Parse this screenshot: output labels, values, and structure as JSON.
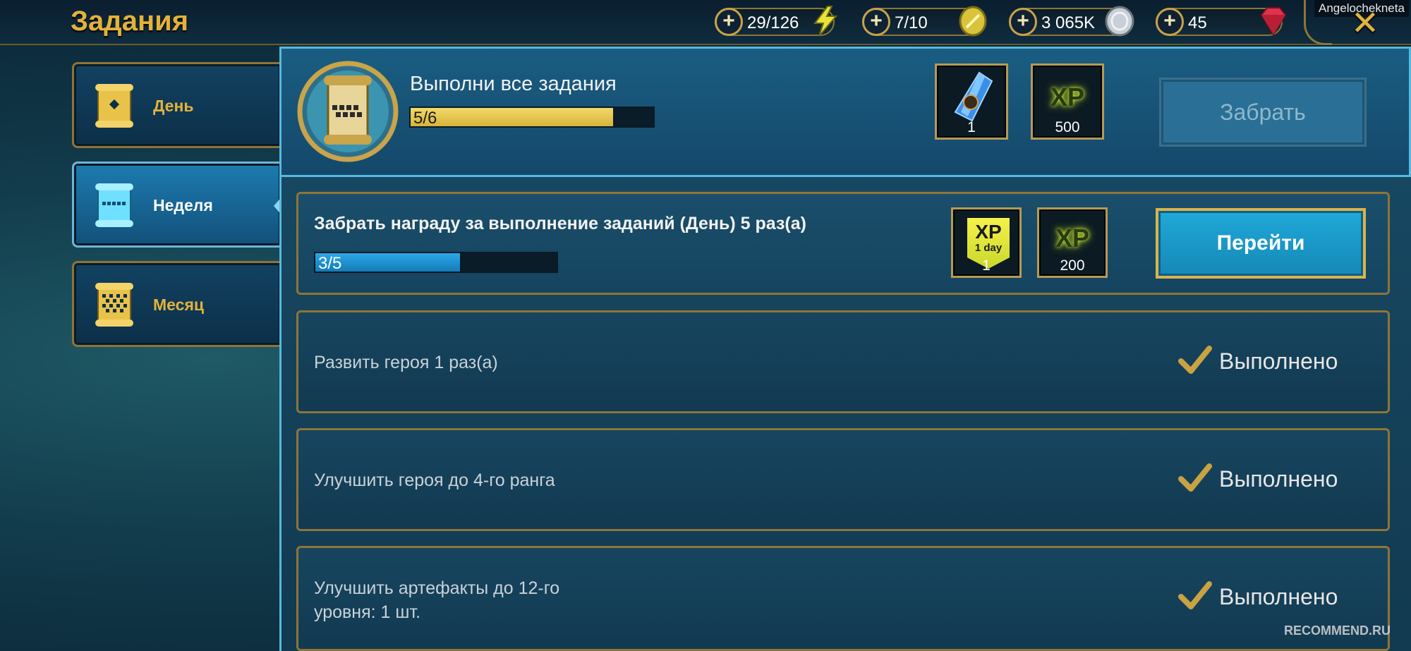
{
  "header": {
    "title": "Задания",
    "username": "Angelochekneta",
    "close_label": "✕"
  },
  "resources": [
    {
      "name": "energy",
      "value": "29/126",
      "icon": "lightning-icon",
      "color": "#e8e23a"
    },
    {
      "name": "arena-tokens",
      "value": "7/10",
      "icon": "gold-token-icon",
      "color": "#d8c33a"
    },
    {
      "name": "silver",
      "value": "3 065K",
      "icon": "silver-coin-icon",
      "color": "#c9cfd6"
    },
    {
      "name": "gems",
      "value": "45",
      "icon": "ruby-gem-icon",
      "color": "#e0324a"
    }
  ],
  "sidebar": {
    "tabs": [
      {
        "label": "День",
        "active": false,
        "icon": "scroll-icon"
      },
      {
        "label": "Неделя",
        "active": true,
        "icon": "scroll-icon"
      },
      {
        "label": "Месяц",
        "active": false,
        "icon": "scroll-icon"
      }
    ]
  },
  "summary": {
    "title": "Выполни все задания",
    "progress_text": "5/6",
    "progress": 0.833,
    "rewards": [
      {
        "type": "shard",
        "icon": "mystery-shard-icon",
        "count": "1"
      },
      {
        "type": "xp",
        "label": "XP",
        "count": "500"
      }
    ],
    "claim_label": "Забрать"
  },
  "tasks": [
    {
      "title": "Забрать награду за выполнение заданий (День) 5 раз(а)",
      "progress_text": "3/5",
      "progress": 0.6,
      "rewards": [
        {
          "type": "xp-boost",
          "label": "XP",
          "sublabel": "1 day",
          "count": "1"
        },
        {
          "type": "xp",
          "label": "XP",
          "count": "200"
        }
      ],
      "action_label": "Перейти"
    },
    {
      "title": "Развить героя 1 раз(а)",
      "status": "Выполнено"
    },
    {
      "title": "Улучшить героя до 4-го ранга",
      "status": "Выполнено"
    },
    {
      "title_line1": "Улучшить артефакты до 12-го",
      "title_line2": "уровня: 1 шт.",
      "status": "Выполнено"
    }
  ],
  "watermark": "RECOMMEND.RU"
}
